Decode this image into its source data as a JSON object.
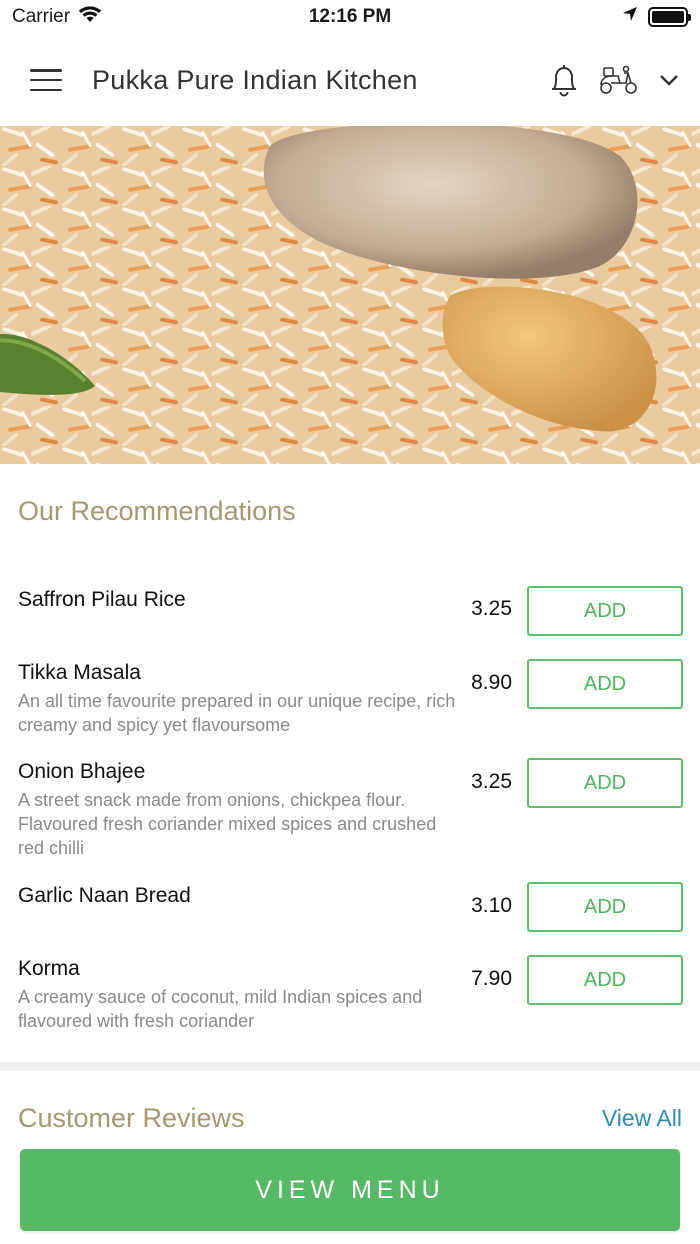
{
  "status_bar": {
    "carrier": "Carrier",
    "time": "12:16 PM",
    "battery_level": 1.0
  },
  "header": {
    "title": "Pukka Pure Indian Kitchen"
  },
  "hero": {
    "image": "biryani-dish-photo"
  },
  "recommendations": {
    "title": "Our Recommendations",
    "add_label": "ADD",
    "items": [
      {
        "name": "Saffron Pilau Rice",
        "description": "",
        "price": "3.25"
      },
      {
        "name": "Tikka Masala",
        "description": "An all time favourite prepared in our unique recipe, rich creamy and spicy yet flavoursome",
        "price": "8.90"
      },
      {
        "name": "Onion Bhajee",
        "description": "A street snack made from onions, chickpea  flour. Flavoured fresh coriander mixed spices and crushed red chilli",
        "price": "3.25"
      },
      {
        "name": "Garlic Naan Bread",
        "description": "",
        "price": "3.10"
      },
      {
        "name": "Korma",
        "description": "A creamy sauce of coconut, mild Indian spices and flavoured with fresh coriander",
        "price": "7.90"
      }
    ]
  },
  "reviews": {
    "title": "Customer Reviews",
    "view_all": "View All"
  },
  "footer": {
    "view_menu": "VIEW MENU"
  },
  "colors": {
    "accent_green": "#57b865",
    "section_title": "#a8976f",
    "link_blue": "#2b8db1"
  }
}
